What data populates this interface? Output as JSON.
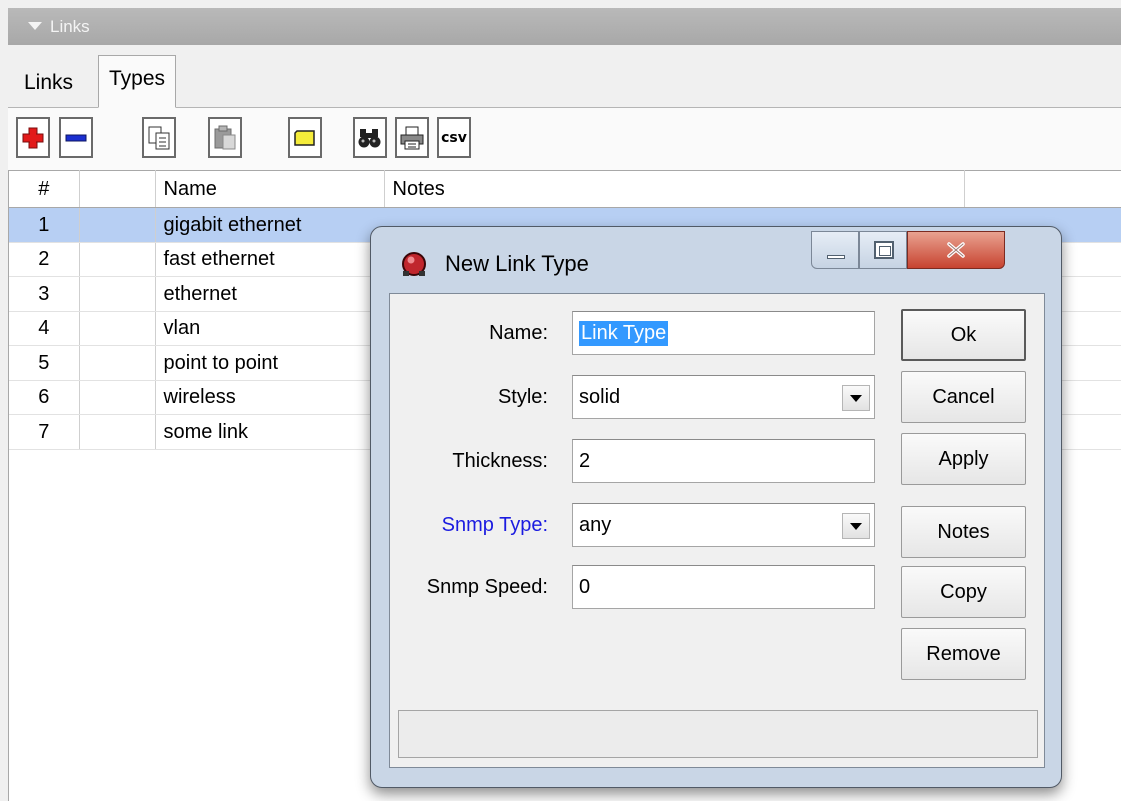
{
  "panel": {
    "title": "Links"
  },
  "tabs": [
    {
      "label": "Links",
      "active": false
    },
    {
      "label": "Types",
      "active": true
    }
  ],
  "toolbar": {
    "buttons": [
      {
        "icon": "plus-icon",
        "color": "#e21a1a"
      },
      {
        "icon": "minus-icon",
        "color": "#1b2fd0"
      },
      {
        "icon": "copy-icon"
      },
      {
        "icon": "paste-icon"
      },
      {
        "icon": "comment-icon",
        "color": "#f5ec3a"
      },
      {
        "icon": "find-icon"
      },
      {
        "icon": "print-icon"
      },
      {
        "icon": "csv-icon",
        "label": "csv"
      }
    ]
  },
  "table": {
    "columns": [
      "#",
      "",
      "Name",
      "Notes",
      ""
    ],
    "rows": [
      {
        "num": "1",
        "name": "gigabit ethernet",
        "selected": true
      },
      {
        "num": "2",
        "name": "fast ethernet"
      },
      {
        "num": "3",
        "name": "ethernet"
      },
      {
        "num": "4",
        "name": "vlan"
      },
      {
        "num": "5",
        "name": "point to point"
      },
      {
        "num": "6",
        "name": "wireless"
      },
      {
        "num": "7",
        "name": "some link"
      }
    ],
    "selection_color": "#b7cff3"
  },
  "dialog": {
    "title": "New Link Type",
    "fields": {
      "name": {
        "label": "Name:",
        "value": "Link Type"
      },
      "style": {
        "label": "Style:",
        "value": "solid"
      },
      "thickness": {
        "label": "Thickness:",
        "value": "2"
      },
      "snmp_type": {
        "label": "Snmp Type:",
        "value": "any",
        "label_color": "#1b1be0"
      },
      "snmp_speed": {
        "label": "Snmp Speed:",
        "value": "0"
      }
    },
    "buttons": {
      "ok": "Ok",
      "cancel": "Cancel",
      "apply": "Apply",
      "notes": "Notes",
      "copy": "Copy",
      "remove": "Remove"
    }
  }
}
